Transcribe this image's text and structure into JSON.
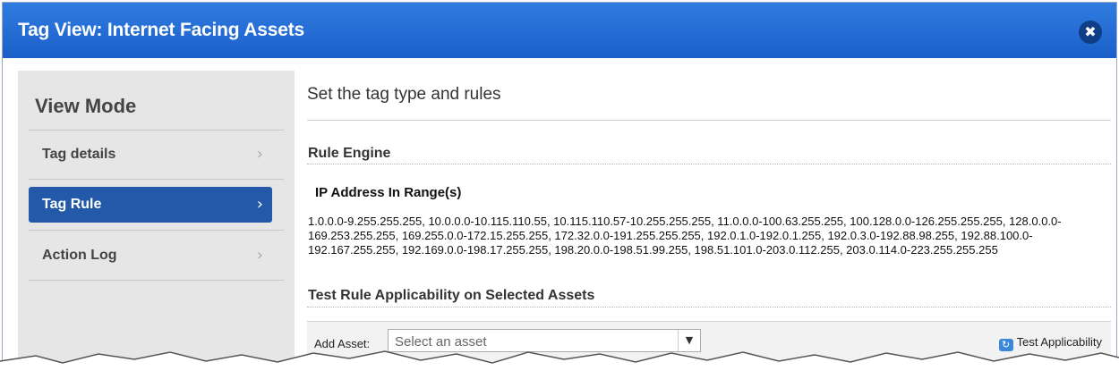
{
  "window": {
    "title": "Tag View: Internet Facing Assets",
    "close_icon": "✖"
  },
  "sidebar": {
    "title": "View Mode",
    "items": [
      {
        "label": "Tag details",
        "active": false
      },
      {
        "label": "Tag Rule",
        "active": true
      },
      {
        "label": "Action Log",
        "active": false
      }
    ],
    "chevron": "›"
  },
  "main": {
    "heading": "Set the tag type and rules",
    "rule_engine_title": "Rule Engine",
    "ip_title": "IP Address In Range(s)",
    "ip_ranges": "1.0.0.0-9.255.255.255, 10.0.0.0-10.115.110.55, 10.115.110.57-10.255.255.255, 11.0.0.0-100.63.255.255, 100.128.0.0-126.255.255.255, 128.0.0.0-169.253.255.255, 169.255.0.0-172.15.255.255, 172.32.0.0-191.255.255.255, 192.0.1.0-192.0.1.255, 192.0.3.0-192.88.98.255, 192.88.100.0-192.167.255.255, 192.169.0.0-198.17.255.255, 198.20.0.0-198.51.99.255, 198.51.101.0-203.0.112.255, 203.0.114.0-223.255.255.255",
    "test_title": "Test Rule Applicability on Selected Assets",
    "add_asset_label": "Add Asset:",
    "select_placeholder": "Select an asset",
    "select_arrow": "▼",
    "test_button_label": "Test Applicability",
    "test_icon": "↻"
  },
  "colors": {
    "titlebar": "#1e66d0",
    "active_item": "#2458a8",
    "sidebar_bg": "#e6e6e6"
  }
}
